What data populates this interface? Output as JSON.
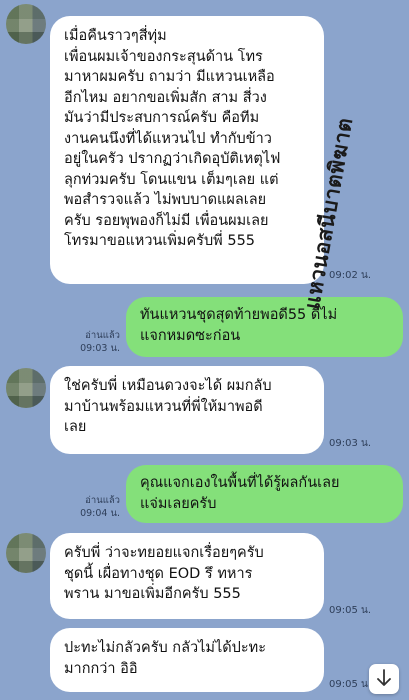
{
  "messages": [
    {
      "text": "เมื่อคืนราวๆสี่ทุ่ม\n เพื่อนผมเจ้าของกระสุนด้าน โทร\nมาหาผมครับ ถามว่า มีแหวนเหลือ\nอีกไหม อยากขอเพิ่มสัก สาม สี่วง\nมันว่ามีประสบการณ์ครับ คือทีม\nงานคนนึงที่ได้แหวนไป ทำกับข้าว\nอยู่ในครัว ปรากฏว่าเกิดอุบัติเหตุไฟ\nลุกท่วมครับ โดนแขน เต็มๆเลย แต่\nพอสำรวจแล้ว ไม่พบบาดแผลเลย\nครับ รอยพุพองก็ไม่มี เพื่อนผมเลย\nโทรมาขอแหวนเพิ่มครับพี่ 555",
      "time": "09:02 น."
    },
    {
      "text": "ทันแหวนชุดสุดท้ายพอดี55 ดีไม่\nแจกหมดซะก่อน",
      "read": "อ่านแล้ว",
      "time": "09:03 น."
    },
    {
      "text": "ใช่ครับพี่ เหมือนดวงจะได้ ผมกลับ\nมาบ้านพร้อมแหวนที่พี่ให้มาพอดี\nเลย",
      "time": "09:03 น."
    },
    {
      "text": "คุณแจกเองในพื้นที่ได้รู้ผลกันเลย\nแจ่มเลยครับ",
      "read": "อ่านแล้ว",
      "time": "09:04 น."
    },
    {
      "text": "ครับพี่ ว่าจะทยอยแจกเรื่อยๆครับ\nชุดนี้ เผื่อทางชุด EOD รึ ทหาร\nพราน มาขอเพิ่มอีกครับ 555",
      "time": "09:05 น."
    },
    {
      "text": "ปะทะไม่กลัวครับ กลัวไม่ได้ปะทะ\nมากกว่า อิอิ",
      "time": "09:05 น."
    }
  ],
  "watermark": "แหวนอสนีบาตพิฆาต",
  "scroll_icon": "chevron-down-icon",
  "colors": {
    "background": "#8ba4cc",
    "incoming": "#ffffff",
    "outgoing": "#84e07a"
  }
}
